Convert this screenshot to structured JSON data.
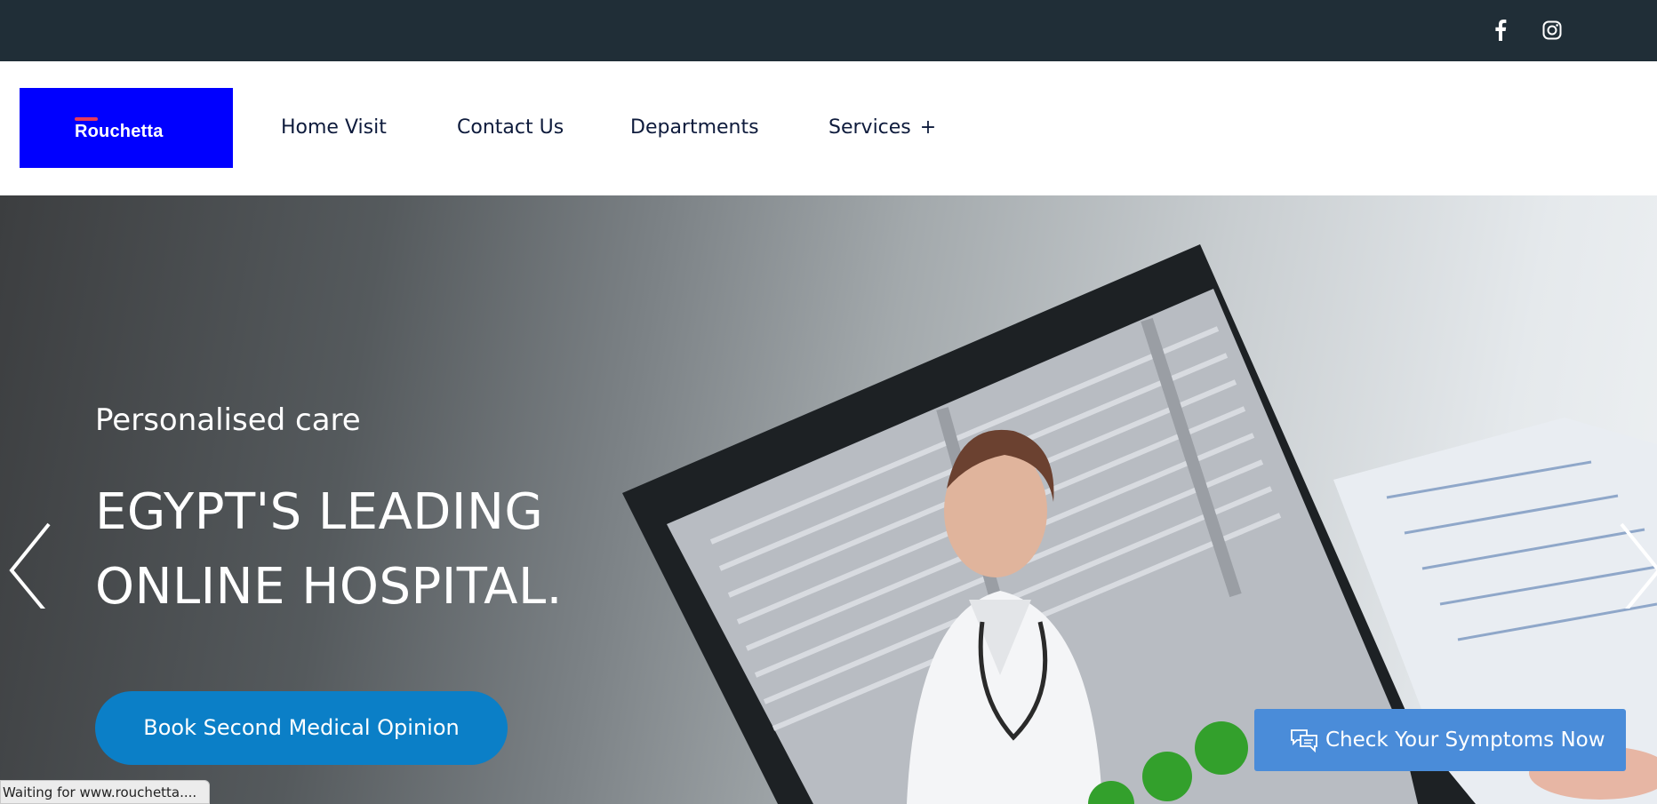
{
  "topbar": {
    "background": "#202e37",
    "social": [
      {
        "icon": "facebook-icon"
      },
      {
        "icon": "instagram-icon"
      }
    ]
  },
  "header": {
    "logo_text": "Rouchetta",
    "logo_background": "#0000ff",
    "nav": [
      {
        "label": "Home Visit"
      },
      {
        "label": "Contact Us"
      },
      {
        "label": "Departments"
      },
      {
        "label": "Services",
        "expand_symbol": "+"
      }
    ]
  },
  "hero": {
    "subtitle": "Personalised care",
    "headline_line1": "EGYPT'S LEADING",
    "headline_line2": "ONLINE HOSPITAL.",
    "cta_label": "Book Second Medical Opinion",
    "cta_color": "#0b7fc7",
    "prev_icon": "chevron-left-icon",
    "next_icon": "chevron-right-icon"
  },
  "floating": {
    "symptoms_label": "Check Your Symptoms Now",
    "symptoms_icon": "chat-bubbles-icon",
    "color": "#4a8cd9"
  },
  "status_bar": {
    "text": "Waiting for www.rouchetta...."
  }
}
